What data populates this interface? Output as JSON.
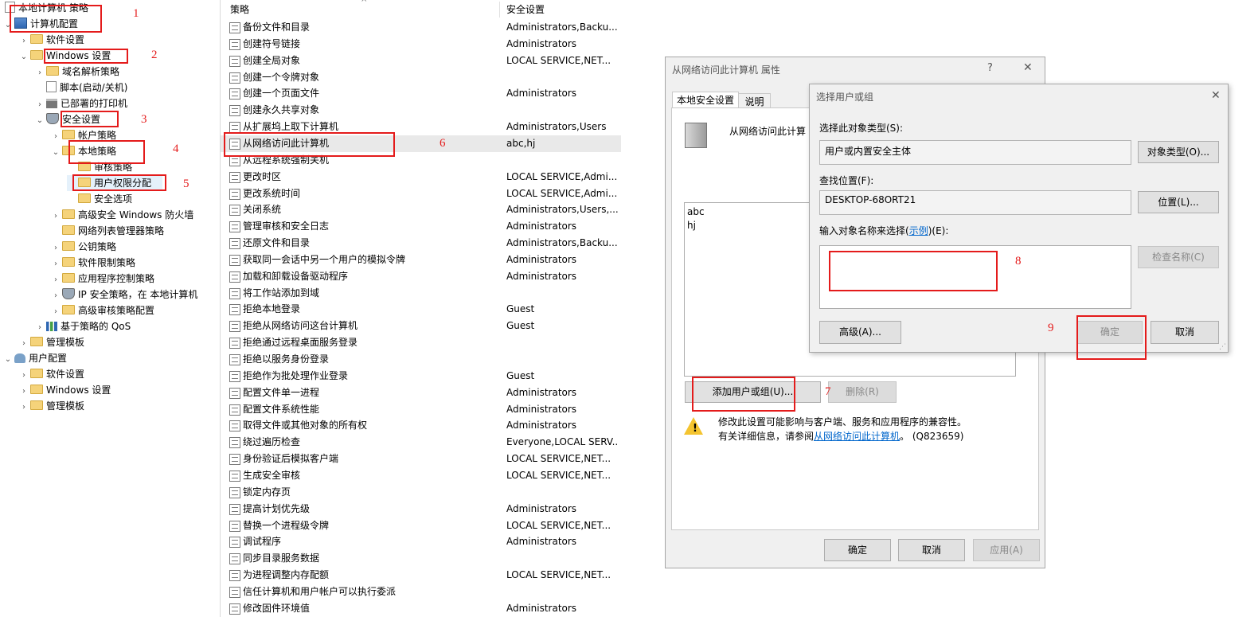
{
  "tree": {
    "root": "本地计算机 策略",
    "computer_config": "计算机配置",
    "software_settings": "软件设置",
    "windows_settings": "Windows 设置",
    "dns_policy": "域名解析策略",
    "scripts": "脚本(启动/关机)",
    "printers": "已部署的打印机",
    "security_settings": "安全设置",
    "account_policy": "帐户策略",
    "local_policy": "本地策略",
    "audit_policy": "审核策略",
    "user_rights": "用户权限分配",
    "security_options": "安全选项",
    "firewall": "高级安全 Windows 防火墙",
    "netlist": "网络列表管理器策略",
    "pubkey": "公钥策略",
    "software_restriction": "软件限制策略",
    "app_control": "应用程序控制策略",
    "ipsec": "IP 安全策略，在 本地计算机",
    "adv_audit": "高级审核策略配置",
    "qos": "基于策略的 QoS",
    "admin_templates": "管理模板",
    "user_config": "用户配置",
    "u_software_settings": "软件设置",
    "u_windows_settings": "Windows 设置",
    "u_admin_templates": "管理模板"
  },
  "list": {
    "col_policy": "策略",
    "col_setting": "安全设置",
    "rows": [
      {
        "name": "备份文件和目录",
        "value": "Administrators,Backu..."
      },
      {
        "name": "创建符号链接",
        "value": "Administrators"
      },
      {
        "name": "创建全局对象",
        "value": "LOCAL SERVICE,NET..."
      },
      {
        "name": "创建一个令牌对象",
        "value": ""
      },
      {
        "name": "创建一个页面文件",
        "value": "Administrators"
      },
      {
        "name": "创建永久共享对象",
        "value": ""
      },
      {
        "name": "从扩展坞上取下计算机",
        "value": "Administrators,Users"
      },
      {
        "name": "从网络访问此计算机",
        "value": "abc,hj"
      },
      {
        "name": "从远程系统强制关机",
        "value": ""
      },
      {
        "name": "更改时区",
        "value": "LOCAL SERVICE,Admi..."
      },
      {
        "name": "更改系统时间",
        "value": "LOCAL SERVICE,Admi..."
      },
      {
        "name": "关闭系统",
        "value": "Administrators,Users,..."
      },
      {
        "name": "管理审核和安全日志",
        "value": "Administrators"
      },
      {
        "name": "还原文件和目录",
        "value": "Administrators,Backu..."
      },
      {
        "name": "获取同一会话中另一个用户的模拟令牌",
        "value": "Administrators"
      },
      {
        "name": "加载和卸载设备驱动程序",
        "value": "Administrators"
      },
      {
        "name": "将工作站添加到域",
        "value": ""
      },
      {
        "name": "拒绝本地登录",
        "value": "Guest"
      },
      {
        "name": "拒绝从网络访问这台计算机",
        "value": "Guest"
      },
      {
        "name": "拒绝通过远程桌面服务登录",
        "value": ""
      },
      {
        "name": "拒绝以服务身份登录",
        "value": ""
      },
      {
        "name": "拒绝作为批处理作业登录",
        "value": "Guest"
      },
      {
        "name": "配置文件单一进程",
        "value": "Administrators"
      },
      {
        "name": "配置文件系统性能",
        "value": "Administrators"
      },
      {
        "name": "取得文件或其他对象的所有权",
        "value": "Administrators"
      },
      {
        "name": "绕过遍历检查",
        "value": "Everyone,LOCAL SERV..."
      },
      {
        "name": "身份验证后模拟客户端",
        "value": "LOCAL SERVICE,NET..."
      },
      {
        "name": "生成安全审核",
        "value": "LOCAL SERVICE,NET..."
      },
      {
        "name": "锁定内存页",
        "value": ""
      },
      {
        "name": "提高计划优先级",
        "value": "Administrators"
      },
      {
        "name": "替换一个进程级令牌",
        "value": "LOCAL SERVICE,NET..."
      },
      {
        "name": "调试程序",
        "value": "Administrators"
      },
      {
        "name": "同步目录服务数据",
        "value": ""
      },
      {
        "name": "为进程调整内存配额",
        "value": "LOCAL SERVICE,NET..."
      },
      {
        "name": "信任计算机和用户帐户可以执行委派",
        "value": ""
      },
      {
        "name": "修改固件环境值",
        "value": "Administrators"
      }
    ]
  },
  "dialog1": {
    "title": "从网络访问此计算机 属性",
    "help": "?",
    "close": "✕",
    "tab_local": "本地安全设置",
    "tab_explain": "说明",
    "policy_name": "从网络访问此计算",
    "members": [
      "abc",
      "hj"
    ],
    "add_button": "添加用户或组(U)...",
    "remove_button": "删除(R)",
    "warning_line1": "修改此设置可能影响与客户端、服务和应用程序的兼容性。",
    "warning_line2_prefix": "有关详细信息，请参阅",
    "warning_link": "从网络访问此计算机",
    "warning_line2_suffix": "。 (Q823659)",
    "ok": "确定",
    "cancel": "取消",
    "apply": "应用(A)"
  },
  "dialog2": {
    "title": "选择用户或组",
    "close": "✕",
    "object_type_label": "选择此对象类型(S):",
    "object_type_value": "用户或内置安全主体",
    "object_type_button": "对象类型(O)...",
    "location_label": "查找位置(F):",
    "location_value": "DESKTOP-68ORT21",
    "location_button": "位置(L)...",
    "enter_label_prefix": "输入对象名称来选择(",
    "enter_label_link": "示例",
    "enter_label_suffix": ")(E):",
    "enter_value": "",
    "check_names": "检查名称(C)",
    "advanced": "高级(A)...",
    "ok": "确定",
    "cancel": "取消"
  },
  "annotations": [
    "1",
    "2",
    "3",
    "4",
    "5",
    "6",
    "7",
    "8",
    "9"
  ]
}
